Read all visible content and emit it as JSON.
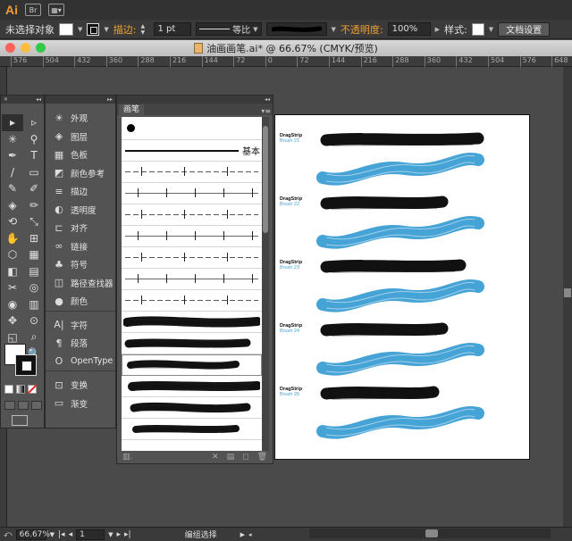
{
  "app": {
    "logo": "Ai",
    "bridge": "Br"
  },
  "control_bar": {
    "selection_label": "未选择对象",
    "stroke_label": "描边:",
    "stroke_weight": "1 pt",
    "stroke_profile": "等比",
    "opacity_label": "不透明度:",
    "opacity_value": "100%",
    "style_label": "样式:",
    "doc_setup_button": "文档设置"
  },
  "window": {
    "title": "油画画笔.ai* @ 66.67% (CMYK/预览)"
  },
  "ruler": {
    "ticks": [
      "576",
      "504",
      "432",
      "360",
      "288",
      "216",
      "144",
      "72",
      "0",
      "72",
      "144",
      "216",
      "288",
      "360",
      "432",
      "504",
      "576",
      "648"
    ]
  },
  "tools": {
    "items": [
      "▸",
      "▹",
      "✳",
      "⚲",
      "✒",
      "T",
      "/",
      "▭",
      "✎",
      "✐",
      "◈",
      "✏",
      "⟲",
      "⤡",
      "✋",
      "⊞",
      "⬡",
      "▦",
      "◧",
      "▤",
      "✂",
      "◎",
      "◉",
      "▥",
      "✥",
      "⊙",
      "◱",
      "⌕",
      "✋",
      "🔍"
    ]
  },
  "panels": {
    "items": [
      {
        "icon": "☀",
        "label": "外观",
        "icon_name": "appearance-icon"
      },
      {
        "icon": "◈",
        "label": "图层",
        "icon_name": "layers-icon"
      },
      {
        "icon": "▦",
        "label": "色板",
        "icon_name": "swatches-icon"
      },
      {
        "icon": "◩",
        "label": "颜色参考",
        "icon_name": "color-guide-icon"
      },
      {
        "icon": "≡",
        "label": "描边",
        "icon_name": "stroke-icon"
      },
      {
        "icon": "◐",
        "label": "透明度",
        "icon_name": "transparency-icon"
      },
      {
        "icon": "⊏",
        "label": "对齐",
        "icon_name": "align-icon"
      },
      {
        "icon": "∞",
        "label": "链接",
        "icon_name": "links-icon"
      },
      {
        "icon": "♣",
        "label": "符号",
        "icon_name": "symbols-icon"
      },
      {
        "icon": "◫",
        "label": "路径查找器",
        "icon_name": "pathfinder-icon"
      },
      {
        "icon": "●",
        "label": "颜色",
        "icon_name": "color-icon"
      },
      {
        "icon": "A|",
        "label": "字符",
        "icon_name": "character-icon"
      },
      {
        "icon": "¶",
        "label": "段落",
        "icon_name": "paragraph-icon"
      },
      {
        "icon": "O",
        "label": "OpenType",
        "icon_name": "opentype-icon"
      },
      {
        "icon": "⊡",
        "label": "变换",
        "icon_name": "transform-icon"
      },
      {
        "icon": "▭",
        "label": "渐变",
        "icon_name": "gradient-icon"
      }
    ]
  },
  "brushes": {
    "tab": "画笔",
    "basic_label": "基本"
  },
  "artboard": {
    "groups": [
      {
        "title": "DragStrip",
        "sub": "Brush 21"
      },
      {
        "title": "DragStrip",
        "sub": "Brush 22"
      },
      {
        "title": "DragStrip",
        "sub": "Brush 23"
      },
      {
        "title": "DragStrip",
        "sub": "Brush 24"
      },
      {
        "title": "DragStrip",
        "sub": "Brush 25"
      }
    ],
    "blue": "#46a3d6"
  },
  "status": {
    "zoom": "66.67%",
    "page": "1",
    "tool_status": "编组选择"
  }
}
